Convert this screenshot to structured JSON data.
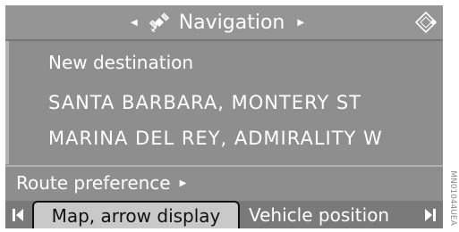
{
  "header": {
    "title": "Navigation",
    "left_arrow_icon": "triangle-left",
    "right_arrow_icon": "triangle-right",
    "title_icon": "satellite-icon",
    "controller_icon": "dpad-icon"
  },
  "menu": {
    "items": [
      {
        "label": "New destination"
      },
      {
        "label": "SANTA BARBARA, MONTERY ST"
      },
      {
        "label": "MARINA DEL REY, ADMIRALITY W"
      }
    ]
  },
  "route": {
    "label": "Route preference",
    "arrow": "▸"
  },
  "bottom": {
    "left_icon": "scroll-left-icon",
    "tabs": [
      {
        "label": "Map, arrow display",
        "selected": true
      },
      {
        "label": "Vehicle position",
        "selected": false
      }
    ],
    "right_icon": "scroll-right-icon"
  },
  "watermark": "MN01044UEA",
  "colors": {
    "background": "#8e8e8e",
    "text": "#ffffff",
    "selected_tab_bg": "#c9c9c9",
    "selected_tab_text": "#111111"
  }
}
